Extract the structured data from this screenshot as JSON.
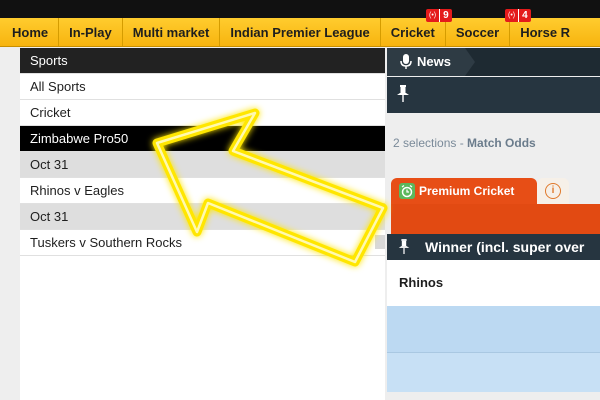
{
  "nav": {
    "items": [
      {
        "label": "Home"
      },
      {
        "label": "In-Play"
      },
      {
        "label": "Multi market"
      },
      {
        "label": "Indian Premier League"
      },
      {
        "label": "Cricket",
        "live_count": "9"
      },
      {
        "label": "Soccer",
        "live_count": "4"
      },
      {
        "label": "Horse R"
      }
    ],
    "live_label": "(•)"
  },
  "sidebar": {
    "header": "Sports",
    "items": [
      "All Sports",
      "Cricket",
      "Zimbabwe Pro50"
    ],
    "dates": [
      "Oct 31",
      "Oct 31"
    ],
    "events": [
      "Rhinos v Eagles",
      "Tuskers v Southern Rocks"
    ]
  },
  "right": {
    "news_tab": "News",
    "selections_count": "2 selections",
    "selections_sep": " - ",
    "market_name": "Match Odds",
    "premium_tab": "Premium Cricket",
    "info_icon": "i",
    "winner_title": "Winner (incl. super over",
    "runner": "Rhinos"
  },
  "colors": {
    "nav_bg": "#f7b40f",
    "accent_orange": "#e74e16",
    "dark_bar": "#263540",
    "odds_blue": "#bcd9f2",
    "arrow_yellow": "#ffe600"
  },
  "icons": {
    "mic": "microphone-icon",
    "pin": "pin-icon",
    "premium": "alarm-clock-icon",
    "info": "info-icon"
  }
}
